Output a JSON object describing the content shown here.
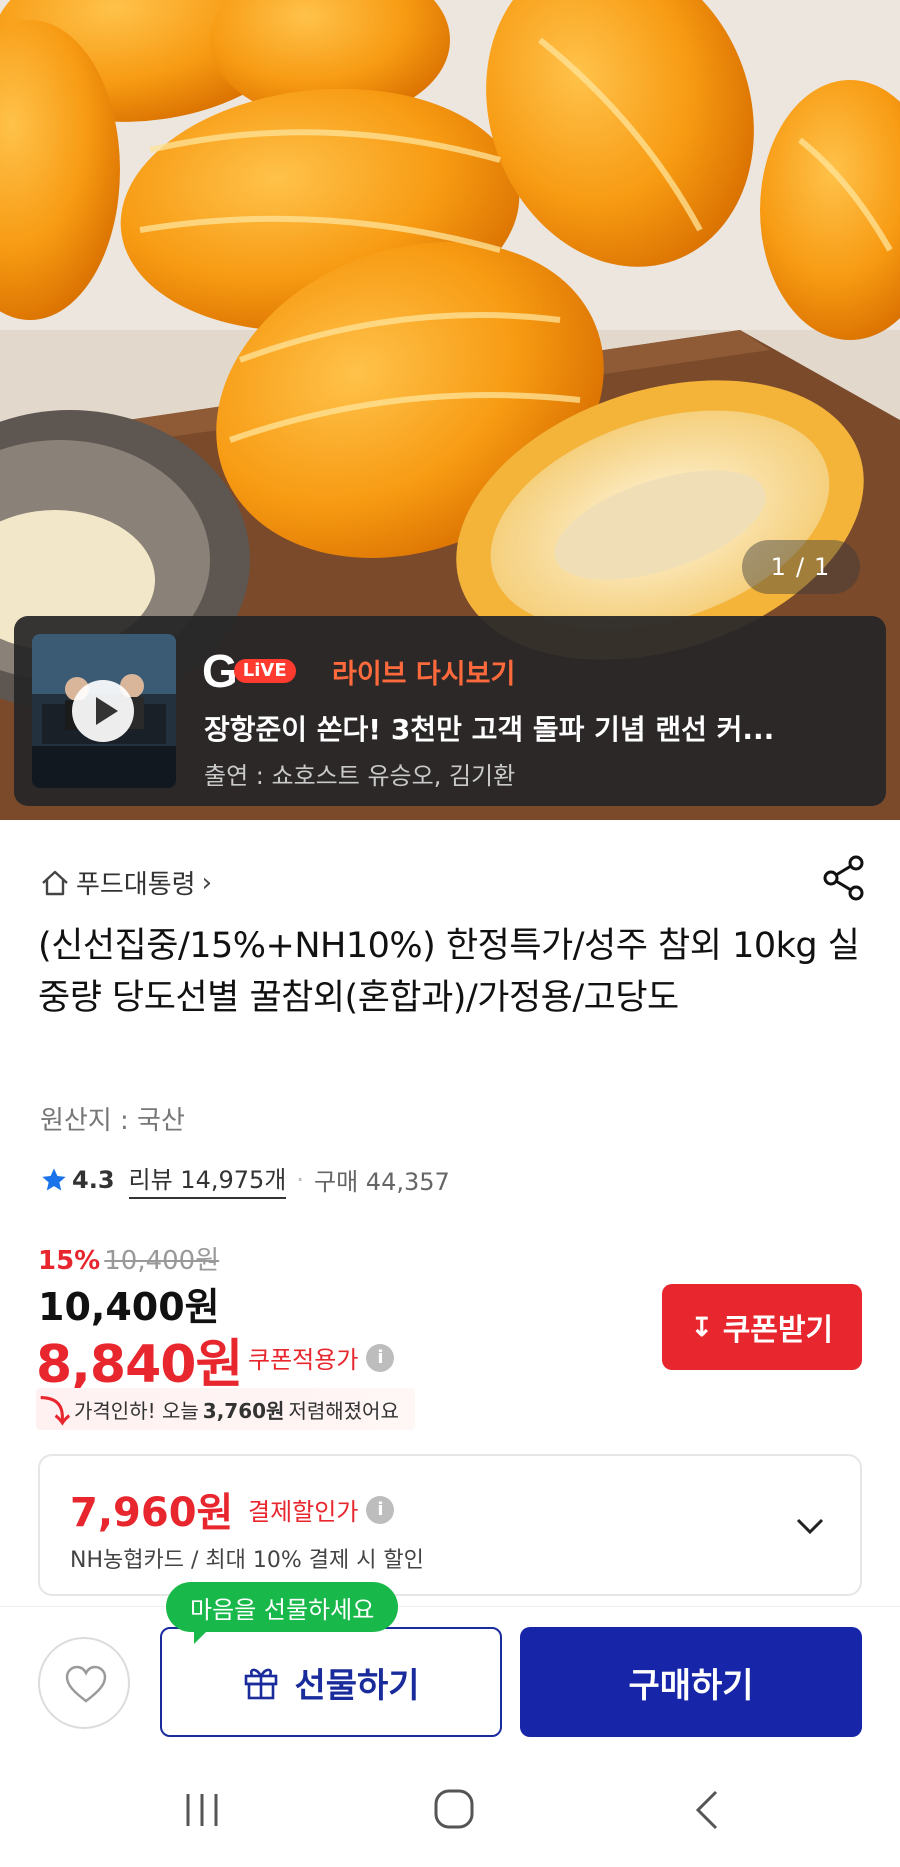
{
  "hero": {
    "image_alt": "오렌지 참외 사진",
    "counter_current": "1",
    "counter_sep": "/",
    "counter_total": "1"
  },
  "live": {
    "logo_g": "G",
    "logo_live": "LiVE",
    "tag": "라이브 다시보기",
    "title": "장항준이 쏜다! 3천만 고객 돌파 기념 랜선 커...",
    "cast": "출연 : 쇼호스트 유승오, 김기환"
  },
  "product": {
    "store": "푸드대통령",
    "title": "(신선집중/15%+NH10%) 한정특가/성주 참외 10kg 실중량 당도선별 꿀참외(혼합과)/가정용/고당도",
    "origin": "원산지 : 국산",
    "rating": "4.3",
    "review": "리뷰 14,975개",
    "sold": "구매 44,357"
  },
  "price": {
    "discount_pct": "15%",
    "original": "10,400원",
    "base": "10,400원",
    "coupon_price": "8,840원",
    "coupon_label": "쿠폰적용가",
    "coupon_button": "쿠폰받기",
    "drop_prefix": "가격인하! 오늘",
    "drop_amount": "3,760원",
    "drop_suffix": "저렴해졌어요"
  },
  "payment": {
    "price": "7,960원",
    "label": "결제할인가",
    "sub": "NH농협카드 / 최대 10% 결제 시 할인"
  },
  "bottom": {
    "gift_tip": "마음을 선물하세요",
    "gift_button": "선물하기",
    "buy_button": "구매하기"
  },
  "colors": {
    "accent_red": "#e8262e",
    "brand_blue": "#1726a8",
    "tip_green": "#19b84a"
  },
  "icons": [
    "home-icon",
    "share-icon",
    "star-icon",
    "info-icon",
    "download-icon",
    "chevron-down-icon",
    "heart-icon",
    "gift-icon",
    "recent-apps-icon",
    "home-nav-icon",
    "back-icon"
  ]
}
